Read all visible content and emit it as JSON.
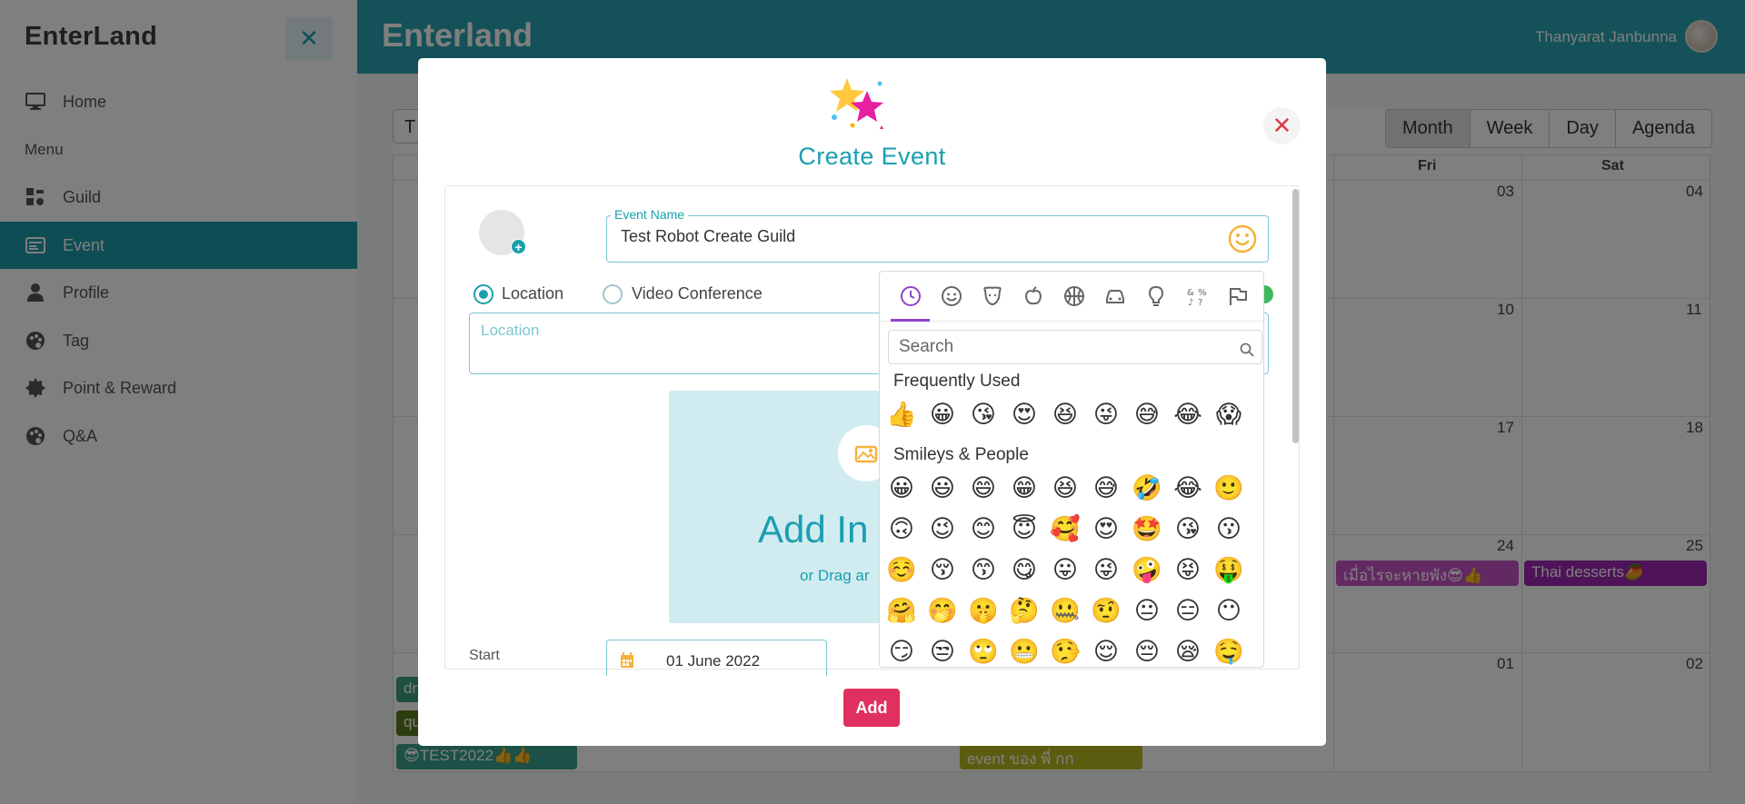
{
  "sidebar": {
    "brand": "EnterLand",
    "close_icon": "close-icon",
    "menu_heading": "Menu",
    "items": [
      {
        "label": "Home",
        "icon": "monitor-icon"
      },
      {
        "label": "Guild",
        "icon": "guild-icon"
      },
      {
        "label": "Event",
        "icon": "event-icon",
        "active": true
      },
      {
        "label": "Profile",
        "icon": "user-icon"
      },
      {
        "label": "Tag",
        "icon": "palette-icon"
      },
      {
        "label": "Point & Reward",
        "icon": "badge-icon"
      },
      {
        "label": "Q&A",
        "icon": "palette-icon"
      }
    ]
  },
  "header": {
    "title": "Enterland",
    "user_name": "Thanyarat Janbunna"
  },
  "calendar": {
    "today_label": "T",
    "views": [
      "Month",
      "Week",
      "Day",
      "Agenda"
    ],
    "active_view": "Month",
    "weekdays_visible": [
      "Fri",
      "Sat"
    ],
    "day_numbers": {
      "row1": [
        "03",
        "04"
      ],
      "row2": [
        "10",
        "11"
      ],
      "row3": [
        "17",
        "18"
      ],
      "row4": [
        "24",
        "25"
      ],
      "row5": [
        "01",
        "02"
      ]
    },
    "events": [
      {
        "label": "เมื่อไรจะหายพัง😎👍",
        "color": "#c653c6"
      },
      {
        "label": "Thai desserts🥭",
        "color": "#9c27b0"
      },
      {
        "label": "dr",
        "color": "#3a9c7e"
      },
      {
        "label": "qu",
        "color": "#5b7a1d"
      },
      {
        "label": "😎TEST2022👍👍",
        "color": "#3aa38f"
      },
      {
        "label": "event ของ พี่ กก",
        "color": "#b9b820"
      }
    ]
  },
  "modal": {
    "title": "Create Event",
    "event_name_label": "Event Name",
    "event_name_value": "Test Robot Create Guild",
    "location_option": "Location",
    "video_option": "Video Conference",
    "location_placeholder": "Location",
    "add_image_text": "Add In",
    "drag_text": "or Drag ar",
    "start_label": "Start",
    "start_value": "01 June 2022",
    "add_button": "Add"
  },
  "emoji_picker": {
    "categories": [
      "recent-icon",
      "smiley-icon",
      "animal-icon",
      "food-icon",
      "activity-icon",
      "travel-icon",
      "objects-icon",
      "symbols-icon",
      "flags-icon"
    ],
    "search_placeholder": "Search",
    "groups": [
      {
        "title": "Frequently Used",
        "rows": [
          [
            "👍",
            "😀",
            "😘",
            "😍",
            "😆",
            "😜",
            "😅",
            "😂",
            "😱"
          ]
        ]
      },
      {
        "title": "Smileys & People",
        "rows": [
          [
            "😀",
            "😃",
            "😄",
            "😁",
            "😆",
            "😅",
            "🤣",
            "😂",
            "🙂"
          ],
          [
            "🙃",
            "😉",
            "😊",
            "😇",
            "🥰",
            "😍",
            "🤩",
            "😘",
            "😗"
          ],
          [
            "☺️",
            "😚",
            "😙",
            "😋",
            "😛",
            "😜",
            "🤪",
            "😝",
            "🤑"
          ],
          [
            "🤗",
            "🤭",
            "🤫",
            "🤔",
            "🤐",
            "🤨",
            "😐",
            "😑",
            "😶"
          ],
          [
            "😏",
            "😒",
            "🙄",
            "😬",
            "🤥",
            "😌",
            "😔",
            "😪",
            "🤤"
          ]
        ]
      }
    ]
  }
}
